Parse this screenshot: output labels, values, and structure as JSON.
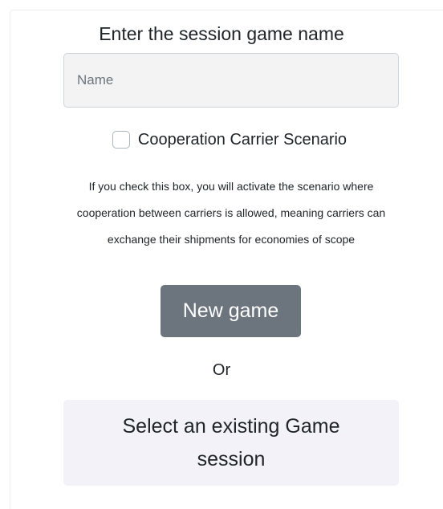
{
  "form": {
    "title": "Enter the session game name",
    "name_input": {
      "placeholder": "Name",
      "value": ""
    },
    "cooperation_checkbox": {
      "label": "Cooperation Carrier Scenario",
      "checked": false
    },
    "description": "If you check this box, you will activate the scenario where cooperation between carriers is allowed, meaning carriers can exchange their shipments for economies of scope",
    "new_game_label": "New game",
    "or_label": "Or",
    "select_existing_label": "Select an existing Game session"
  },
  "colors": {
    "button_bg": "#6c757d",
    "input_bg": "#f3f3f3",
    "select_bg": "#f3f2f8"
  }
}
